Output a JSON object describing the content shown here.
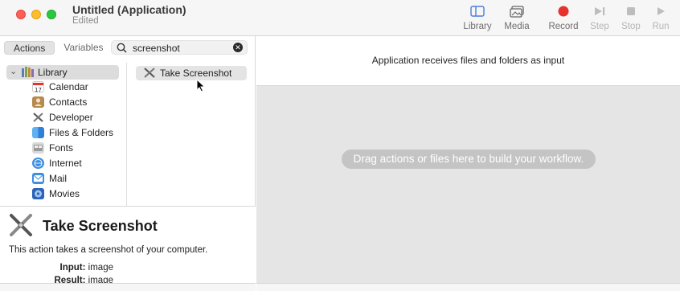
{
  "window": {
    "title": "Untitled (Application)",
    "subtitle": "Edited"
  },
  "toolbar": {
    "library_label": "Library",
    "media_label": "Media",
    "record_label": "Record",
    "step_label": "Step",
    "stop_label": "Stop",
    "run_label": "Run",
    "record_color": "#e5322d"
  },
  "left": {
    "tabs": {
      "actions": "Actions",
      "variables": "Variables"
    },
    "search": {
      "value": "screenshot"
    },
    "library": {
      "root": "Library",
      "items": [
        {
          "label": "Calendar",
          "icon": "calendar-icon"
        },
        {
          "label": "Contacts",
          "icon": "contacts-icon"
        },
        {
          "label": "Developer",
          "icon": "developer-icon"
        },
        {
          "label": "Files & Folders",
          "icon": "finder-icon"
        },
        {
          "label": "Fonts",
          "icon": "fonts-icon"
        },
        {
          "label": "Internet",
          "icon": "internet-icon"
        },
        {
          "label": "Mail",
          "icon": "mail-icon"
        },
        {
          "label": "Movies",
          "icon": "movies-icon"
        }
      ]
    },
    "results": [
      {
        "label": "Take Screenshot"
      }
    ],
    "description": {
      "title": "Take Screenshot",
      "text": "This action takes a screenshot of your computer.",
      "input_label": "Input:",
      "input_value": "image",
      "result_label": "Result:",
      "result_value": "image"
    }
  },
  "workflow": {
    "header": "Application receives files and folders as input",
    "placeholder": "Drag actions or files here to build your workflow."
  }
}
